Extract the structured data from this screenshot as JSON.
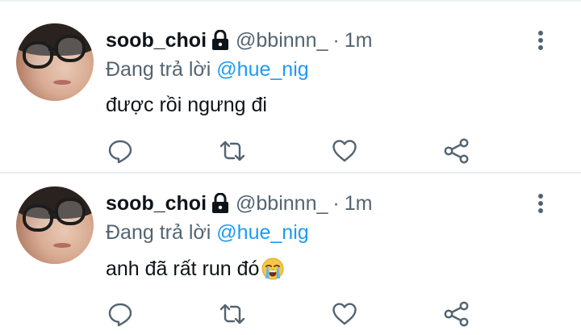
{
  "tweets": [
    {
      "display_name": "soob_choi",
      "handle": "@bbinnn_",
      "separator": "·",
      "time": "1m",
      "reply_prefix": "Đang trả lời",
      "reply_to": "@hue_nig",
      "text": "được rồi ngưng đi",
      "emoji": ""
    },
    {
      "display_name": "soob_choi",
      "handle": "@bbinnn_",
      "separator": "·",
      "time": "1m",
      "reply_prefix": "Đang trả lời",
      "reply_to": "@hue_nig",
      "text": "anh đã rất run đó",
      "emoji": "loudly-crying-face"
    }
  ],
  "icons": {
    "reply": "reply-icon",
    "retweet": "retweet-icon",
    "like": "heart-icon",
    "share": "share-icon",
    "more": "more-vertical-icon",
    "lock": "lock-icon"
  },
  "colors": {
    "text": "#0f1419",
    "secondary": "#536471",
    "link": "#1d9bf0",
    "divider": "#e6ecf0"
  }
}
